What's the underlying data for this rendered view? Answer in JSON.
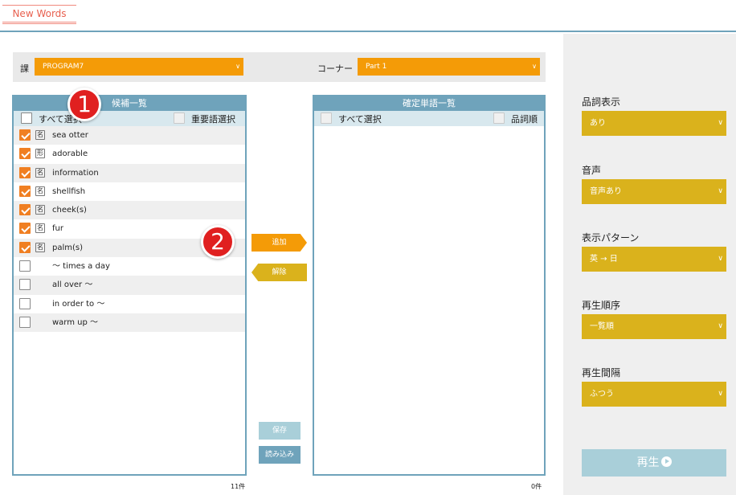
{
  "header": {
    "tab_label": "New Words"
  },
  "filter": {
    "lesson_label": "課",
    "lesson_value": "PROGRAM7",
    "corner_label": "コーナー",
    "corner_value": "Part 1"
  },
  "candidates": {
    "title": "候補一覧",
    "select_all": "すべて選択",
    "important_select": "重要語選択",
    "count": "11件",
    "items": [
      {
        "pos": "名",
        "word": "sea otter",
        "checked": true
      },
      {
        "pos": "形",
        "word": "adorable",
        "checked": true
      },
      {
        "pos": "名",
        "word": "information",
        "checked": true
      },
      {
        "pos": "名",
        "word": "shellfish",
        "checked": true
      },
      {
        "pos": "名",
        "word": "cheek(s)",
        "checked": true
      },
      {
        "pos": "名",
        "word": "fur",
        "checked": true
      },
      {
        "pos": "名",
        "word": "palm(s)",
        "checked": true
      },
      {
        "pos": "",
        "word": "～ times a day",
        "checked": false
      },
      {
        "pos": "",
        "word": "all over ～",
        "checked": false
      },
      {
        "pos": "",
        "word": "in order to ～",
        "checked": false
      },
      {
        "pos": "",
        "word": "warm up ～",
        "checked": false
      }
    ]
  },
  "confirmed": {
    "title": "確定単語一覧",
    "select_all": "すべて選択",
    "pos_order": "品詞順",
    "count": "0件"
  },
  "actions": {
    "add": "追加",
    "remove": "解除",
    "save": "保存",
    "load": "読み込み"
  },
  "badges": {
    "one": "1",
    "two": "2"
  },
  "options": {
    "pos_display_label": "品詞表示",
    "pos_display_value": "あり",
    "audio_label": "音声",
    "audio_value": "音声あり",
    "pattern_label": "表示パターン",
    "pattern_value": "英 → 日",
    "order_label": "再生順序",
    "order_value": "一覧順",
    "interval_label": "再生間隔",
    "interval_value": "ふつう",
    "play_label": "再生"
  },
  "colors": {
    "accent_orange": "#f49b07",
    "accent_gold": "#dab21c",
    "frame_blue": "#6fa3bb",
    "badge_red": "#e02020"
  }
}
